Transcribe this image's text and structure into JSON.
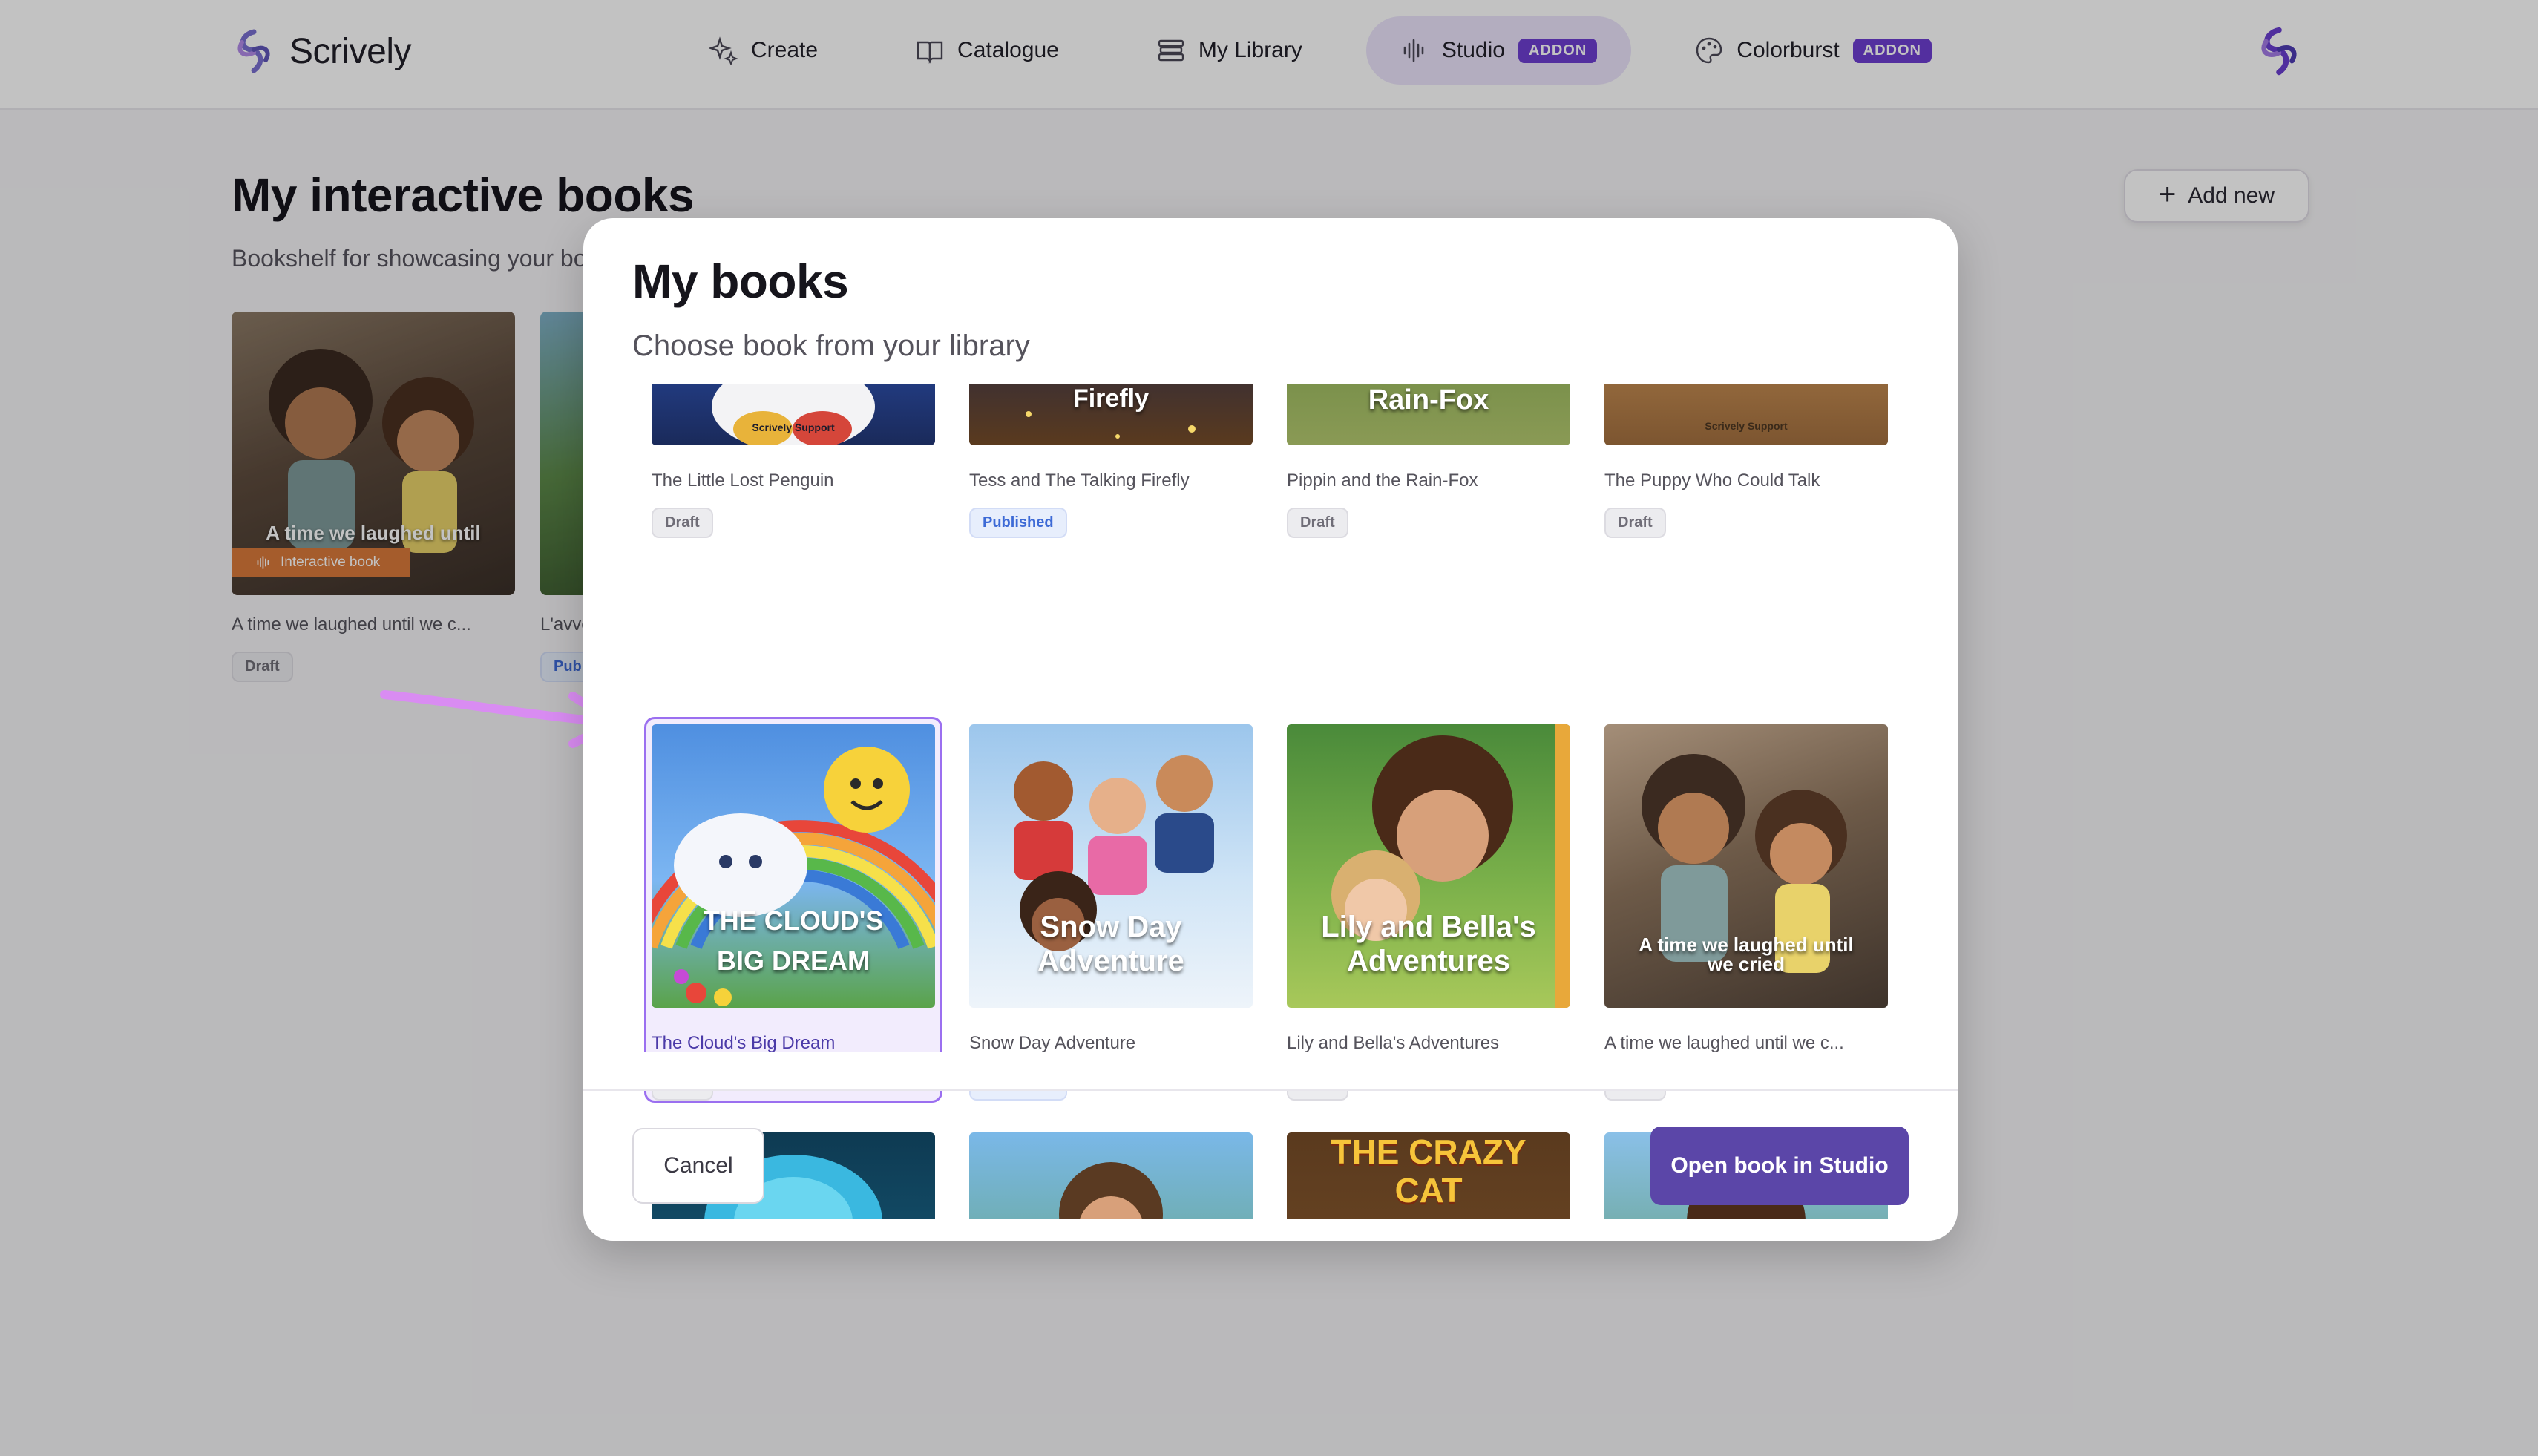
{
  "app": {
    "name": "Scrively"
  },
  "nav": {
    "items": [
      {
        "label": "Create",
        "icon": "sparkle-icon",
        "active": false,
        "addon": ""
      },
      {
        "label": "Catalogue",
        "icon": "open-book-icon",
        "active": false,
        "addon": ""
      },
      {
        "label": "My Library",
        "icon": "books-icon",
        "active": false,
        "addon": ""
      },
      {
        "label": "Studio",
        "icon": "soundwave-icon",
        "active": true,
        "addon": "ADDON"
      },
      {
        "label": "Colorburst",
        "icon": "palette-icon",
        "active": false,
        "addon": "ADDON"
      }
    ]
  },
  "page": {
    "title": "My interactive books",
    "subtitle": "Bookshelf for showcasing your bo",
    "add_new_label": "Add new",
    "books": [
      {
        "title": "A time we laughed until we c...",
        "cover_text": "A time we laughed until",
        "tag": "Interactive book",
        "status": "Draft"
      },
      {
        "title": "L'avve",
        "cover_text": "L",
        "tag": "",
        "status": "Publ"
      }
    ]
  },
  "modal": {
    "title": "My books",
    "subtitle": "Choose book from your library",
    "top_row": [
      {
        "title": "The Little Lost Penguin",
        "status": "Draft",
        "cover_text": "Scrively Support"
      },
      {
        "title": "Tess and The Talking Firefly",
        "status": "Published",
        "cover_text": "Firefly"
      },
      {
        "title": "Pippin and the Rain-Fox",
        "status": "Draft",
        "cover_text": "Rain-Fox"
      },
      {
        "title": "The Puppy Who Could Talk",
        "status": "Draft",
        "cover_text": "Scrively Support"
      }
    ],
    "middle_row": [
      {
        "title": "The Cloud's Big Dream",
        "status": "Draft",
        "cover_text": "THE CLOUD'S BIG DREAM",
        "selected": true
      },
      {
        "title": "Snow Day Adventure",
        "status": "Published",
        "cover_text": "Snow Day Adventure",
        "selected": false
      },
      {
        "title": "Lily and Bella's Adventures",
        "status": "Draft",
        "cover_text": "Lily and Bella's Adventures",
        "selected": false
      },
      {
        "title": "A time we laughed until we c...",
        "status": "Draft",
        "cover_text": "A time we laughed until we cried",
        "selected": false
      }
    ],
    "bottom_row": [
      {
        "cover_text": ""
      },
      {
        "cover_text": ""
      },
      {
        "cover_text": "THE CRAZY CAT"
      },
      {
        "cover_text": ""
      }
    ],
    "cancel_label": "Cancel",
    "open_label": "Open book in Studio"
  },
  "colors": {
    "accent": "#5b46a8",
    "addon_badge": "#6d3fd1",
    "active_nav": "#ebe4fb",
    "selection_border": "#9b6ff0",
    "draft_chip": "#ececef",
    "published_chip": "#e7eefc"
  }
}
